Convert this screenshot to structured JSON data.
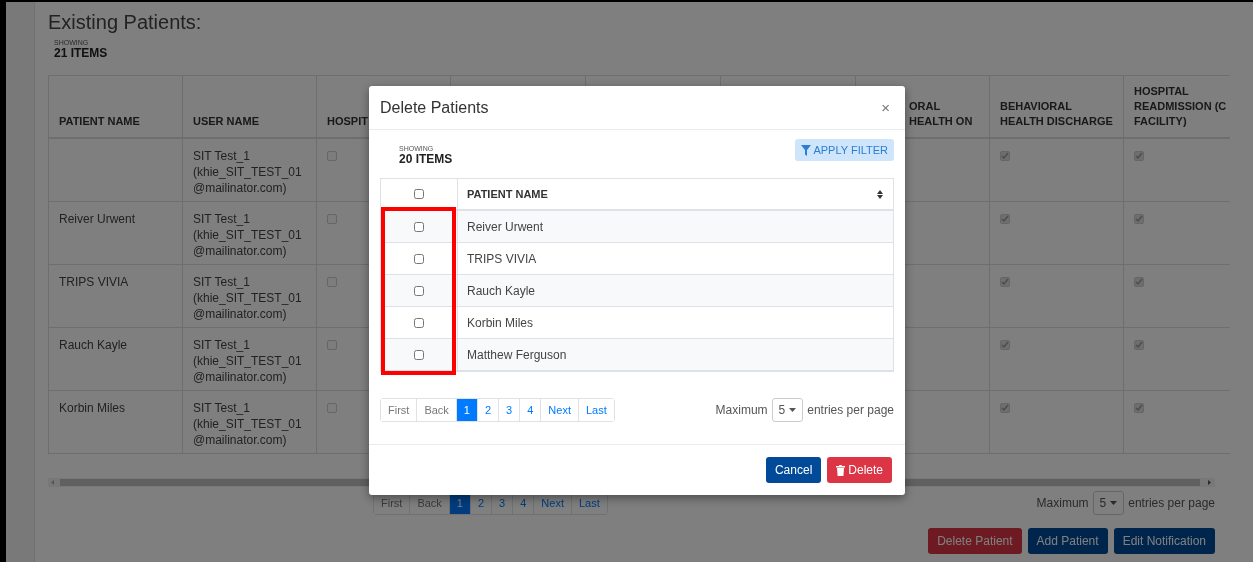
{
  "page": {
    "title": "Existing Patients:",
    "showing_label": "SHOWING",
    "showing_count": "21 ITEMS",
    "columns": [
      {
        "label": "PATIENT NAME"
      },
      {
        "label": "USER NAME"
      },
      {
        "label": "HOSPIT"
      },
      {
        "label": "ORAL HEALTH ON"
      },
      {
        "label": "BEHAVIORAL HEALTH DISCHARGE"
      },
      {
        "label": "HOSPITAL\nREADMISSION (C\nFACILITY)"
      }
    ],
    "rows": [
      {
        "user_name": "SIT Test_1 (khie_SIT_TEST_01@mailinator.com)",
        "hospital_checked": false,
        "discharge_checked": true,
        "readmission_checked": true
      },
      {
        "patient_name": "Reiver Urwent",
        "user_name": "SIT Test_1 (khie_SIT_TEST_01@mailinator.com)",
        "hospital_checked": false,
        "discharge_checked": true,
        "readmission_checked": true
      },
      {
        "patient_name": "TRIPS VIVIA",
        "user_name": "SIT Test_1 (khie_SIT_TEST_01@mailinator.com)",
        "hospital_checked": false,
        "discharge_checked": true,
        "readmission_checked": true
      },
      {
        "patient_name": "Rauch Kayle",
        "user_name": "SIT Test_1 (khie_SIT_TEST_01@mailinator.com)",
        "hospital_checked": false,
        "discharge_checked": true,
        "readmission_checked": true
      },
      {
        "patient_name": "Korbin Miles",
        "user_name": "SIT Test_1 (khie_SIT_TEST_01@mailinator.com)",
        "hospital_checked": false,
        "discharge_checked": true,
        "readmission_checked": true
      }
    ],
    "pagination": [
      {
        "label": "First",
        "selected": false
      },
      {
        "label": "Back",
        "selected": false
      },
      {
        "label": "1",
        "selected": true
      },
      {
        "label": "2",
        "selected": false
      },
      {
        "label": "3",
        "selected": false
      },
      {
        "label": "4",
        "selected": false
      },
      {
        "label": "Next",
        "selected": false
      },
      {
        "label": "Last",
        "selected": false
      }
    ],
    "per_page": {
      "before": "Maximum",
      "value": "5",
      "after": "entries per page"
    },
    "buttons": [
      {
        "label": "Delete Patient",
        "kind": "danger"
      },
      {
        "label": "Add Patient",
        "kind": "primary"
      },
      {
        "label": "Edit Notification",
        "kind": "primary"
      }
    ]
  },
  "dialog": {
    "title": "Delete Patients",
    "close": "×",
    "showing_label": "SHOWING",
    "showing_count": "20 ITEMS",
    "filter_button": "APPLY FILTER",
    "header": {
      "label": "PATIENT NAME",
      "checked": false
    },
    "rows": [
      {
        "name": "Reiver Urwent",
        "checked": false
      },
      {
        "name": "TRIPS VIVIA",
        "checked": false
      },
      {
        "name": "Rauch Kayle",
        "checked": false
      },
      {
        "name": "Korbin Miles",
        "checked": false
      },
      {
        "name": "Matthew Ferguson",
        "checked": false
      }
    ],
    "pagination": [
      {
        "label": "First",
        "selected": false
      },
      {
        "label": "Back",
        "selected": false
      },
      {
        "label": "1",
        "selected": true
      },
      {
        "label": "2",
        "selected": false
      },
      {
        "label": "3",
        "selected": false
      },
      {
        "label": "4",
        "selected": false
      },
      {
        "label": "Next",
        "selected": false
      },
      {
        "label": "Last",
        "selected": false
      }
    ],
    "per_page": {
      "before": "Maximum",
      "value": "5",
      "after": "entries per page"
    },
    "buttons": [
      {
        "label": "Cancel",
        "kind": "primary"
      },
      {
        "label": "Delete",
        "kind": "danger"
      }
    ]
  }
}
